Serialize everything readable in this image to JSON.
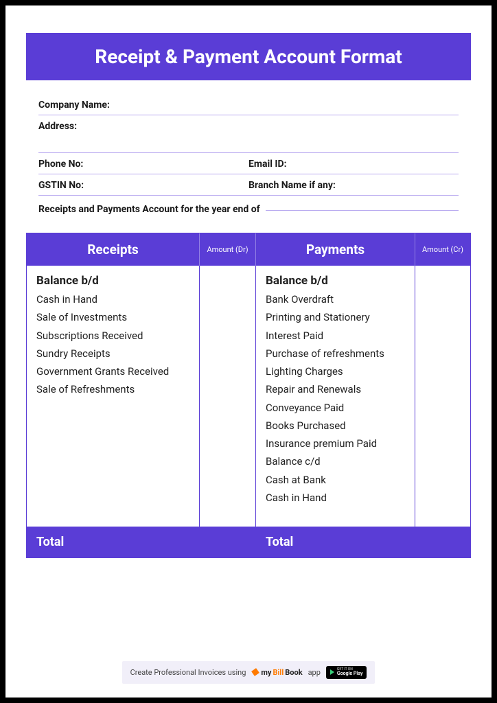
{
  "title": "Receipt & Payment Account Format",
  "info": {
    "company": "Company Name:",
    "address": "Address:",
    "phone": "Phone No:",
    "email": "Email ID:",
    "gstin": "GSTIN No:",
    "branch": "Branch Name if any:",
    "year_end": "Receipts and Payments Account for the year end of"
  },
  "headers": {
    "receipts": "Receipts",
    "amount_dr": "Amount (Dr)",
    "payments": "Payments",
    "amount_cr": "Amount (Cr)"
  },
  "receipts": {
    "balance": "Balance b/d",
    "items": [
      "Cash in Hand",
      "Sale of Investments",
      "Subscriptions Received",
      "Sundry Receipts",
      "Government Grants Received",
      "Sale of Refreshments"
    ]
  },
  "payments": {
    "balance": "Balance b/d",
    "items": [
      "Bank Overdraft",
      "Printing and Stationery",
      "Interest Paid",
      "Purchase of refreshments",
      "Lighting Charges",
      "Repair and Renewals",
      "Conveyance Paid",
      "Books Purchased",
      "Insurance premium Paid",
      "Balance c/d",
      "Cash at Bank",
      "Cash in Hand"
    ]
  },
  "totals": {
    "left": "Total",
    "right": "Total"
  },
  "footer": {
    "text": "Create Professional Invoices using",
    "brand_my": "my",
    "brand_bill": "Bill",
    "brand_book": "Book",
    "app": "app",
    "gplay_l1": "GET IT ON",
    "gplay_l2": "Google Play"
  }
}
